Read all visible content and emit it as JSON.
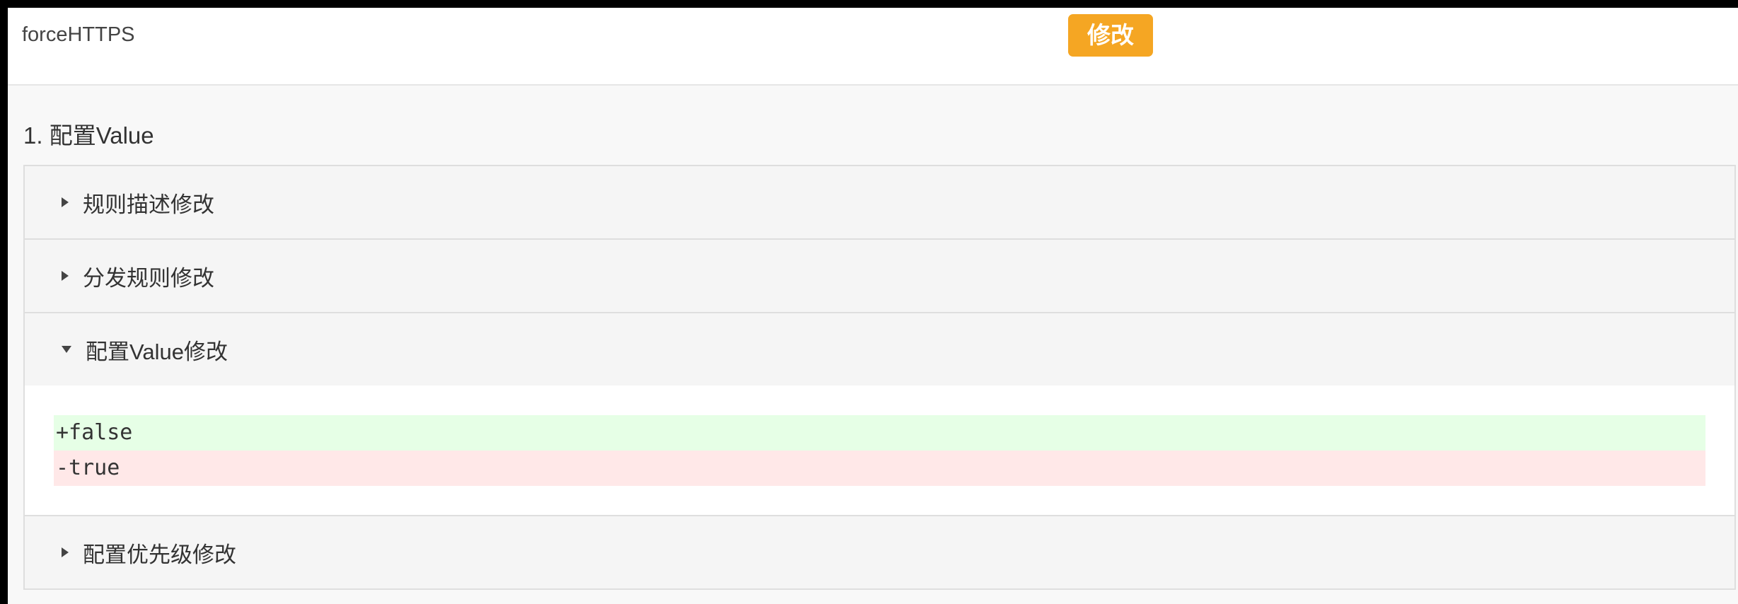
{
  "header": {
    "name": "forceHTTPS",
    "badge": "修改",
    "badge_color": "#f5a623"
  },
  "section": {
    "title": "1. 配置Value"
  },
  "accordion": {
    "items": [
      {
        "label": "规则描述修改",
        "expanded": false
      },
      {
        "label": "分发规则修改",
        "expanded": false
      },
      {
        "label": "配置Value修改",
        "expanded": true
      },
      {
        "label": "配置优先级修改",
        "expanded": false
      }
    ]
  },
  "diff": {
    "added": "+false",
    "removed": "-true",
    "added_color": "#e6ffe6",
    "removed_color": "#ffe8e8"
  },
  "icons": {
    "collapsed": "caret-right-icon",
    "expanded": "caret-down-icon"
  }
}
